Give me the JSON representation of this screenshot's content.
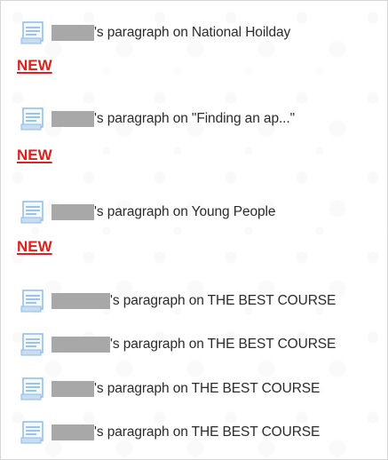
{
  "items": [
    {
      "text": "'s paragraph on National Hoilday",
      "icon": "document-icon"
    },
    {
      "text": "'s paragraph on \"Finding an ap...\"",
      "icon": "document-icon"
    },
    {
      "text": "'s paragraph on Young People",
      "icon": "document-icon"
    },
    {
      "text": "'s paragraph on THE BEST COURSE",
      "icon": "document-icon"
    },
    {
      "text": "'s paragraph on THE BEST COURSE",
      "icon": "document-icon"
    },
    {
      "text": "'s paragraph on THE BEST COURSE",
      "icon": "document-icon"
    },
    {
      "text": "'s paragraph on THE BEST COURSE",
      "icon": "document-icon"
    }
  ],
  "new_labels": [
    "NEW",
    "NEW",
    "NEW"
  ],
  "colors": {
    "new_label": "#e0201b",
    "text": "#2b2b2b",
    "redaction": "#a8a8a8",
    "icon_blue": "#7fb0e0"
  }
}
